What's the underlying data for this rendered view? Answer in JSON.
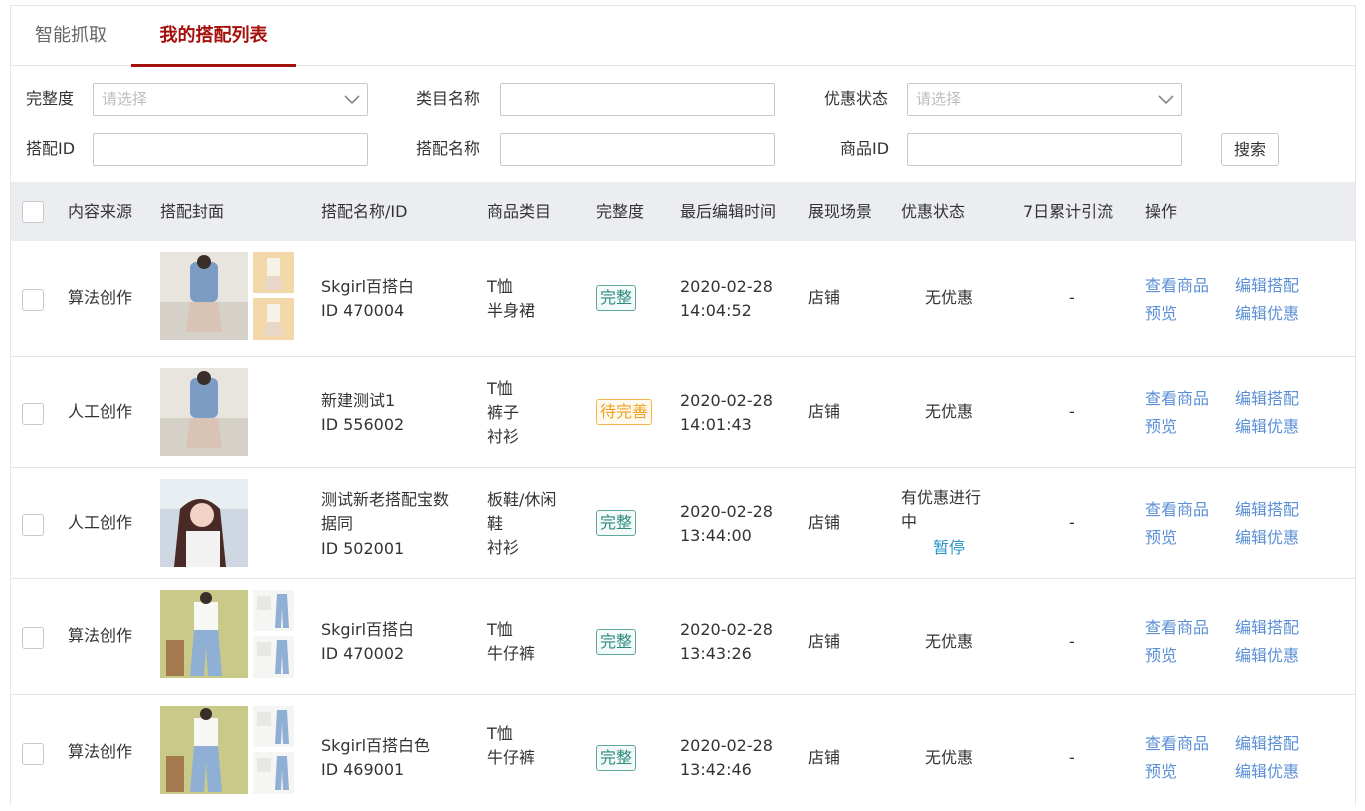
{
  "tabs": [
    {
      "label": "智能抓取"
    },
    {
      "label": "我的搭配列表"
    }
  ],
  "filters": {
    "completeness": {
      "label": "完整度",
      "placeholder": "请选择"
    },
    "category_name": {
      "label": "类目名称",
      "value": ""
    },
    "promo_status": {
      "label": "优惠状态",
      "placeholder": "请选择"
    },
    "combo_id": {
      "label": "搭配ID",
      "value": ""
    },
    "combo_name": {
      "label": "搭配名称",
      "value": ""
    },
    "product_id": {
      "label": "商品ID",
      "value": ""
    },
    "search_label": "搜索"
  },
  "table": {
    "headers": [
      "内容来源",
      "搭配封面",
      "搭配名称/ID",
      "商品类目",
      "完整度",
      "最后编辑时间",
      "展现场景",
      "优惠状态",
      "7日累计引流",
      "操作"
    ],
    "actions": {
      "view": "查看商品",
      "edit": "编辑搭配",
      "preview": "预览",
      "edit_promo": "编辑优惠"
    },
    "rows": [
      {
        "source": "算法创作",
        "name": "Skgirl百搭白",
        "id": "ID 470004",
        "categories": [
          "T恤",
          "半身裙"
        ],
        "completeness": "完整",
        "completeness_status": "ok",
        "date": "2020-02-28",
        "time": "14:04:52",
        "scene": "店铺",
        "promo": "无优惠",
        "traffic": "-"
      },
      {
        "source": "人工创作",
        "name": "新建测试1",
        "id": "ID 556002",
        "categories": [
          "T恤",
          "裤子",
          "衬衫"
        ],
        "completeness": "待完善",
        "completeness_status": "warn",
        "date": "2020-02-28",
        "time": "14:01:43",
        "scene": "店铺",
        "promo": "无优惠",
        "traffic": "-"
      },
      {
        "source": "人工创作",
        "name_lines": [
          "测试新老搭配宝数",
          "据同"
        ],
        "id": "ID 502001",
        "categories": [
          "板鞋/休闲",
          "鞋",
          "衬衫"
        ],
        "completeness": "完整",
        "completeness_status": "ok",
        "date": "2020-02-28",
        "time": "13:44:00",
        "scene": "店铺",
        "promo_lines": [
          "有优惠进行",
          "中"
        ],
        "promo_action": "暂停",
        "traffic": "-"
      },
      {
        "source": "算法创作",
        "name": "Skgirl百搭白",
        "id": "ID 470002",
        "categories": [
          "T恤",
          "牛仔裤"
        ],
        "completeness": "完整",
        "completeness_status": "ok",
        "date": "2020-02-28",
        "time": "13:43:26",
        "scene": "店铺",
        "promo": "无优惠",
        "traffic": "-"
      },
      {
        "source": "算法创作",
        "name": "Skgirl百搭白色",
        "id": "ID 469001",
        "categories": [
          "T恤",
          "牛仔裤"
        ],
        "completeness": "完整",
        "completeness_status": "ok",
        "date": "2020-02-28",
        "time": "13:42:46",
        "scene": "店铺",
        "promo": "无优惠",
        "traffic": "-"
      }
    ]
  },
  "colors": {
    "accent": "#a5110c",
    "link": "#5a8fd6",
    "ok": "#2d8a7e",
    "warn": "#f0a020",
    "header_bg": "#ebedf0"
  }
}
